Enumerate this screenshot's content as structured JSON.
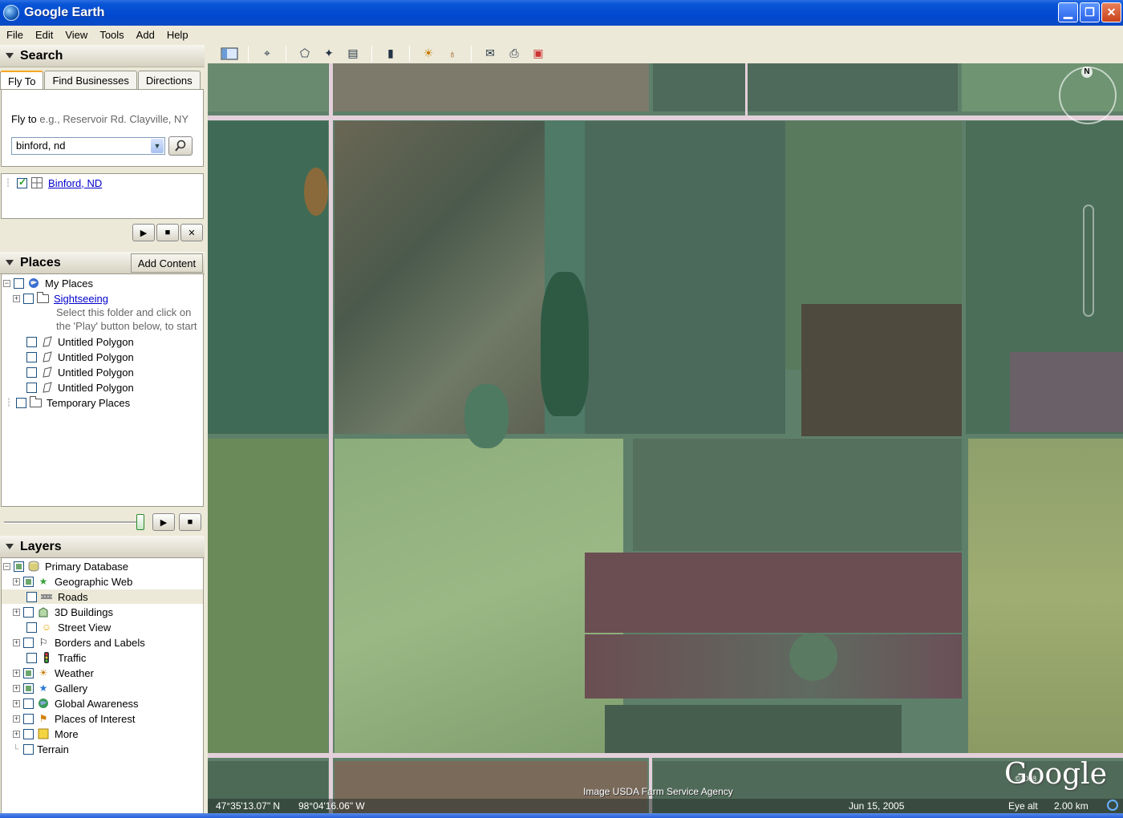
{
  "window": {
    "title": "Google Earth"
  },
  "menu": [
    "File",
    "Edit",
    "View",
    "Tools",
    "Add",
    "Help"
  ],
  "search": {
    "header": "Search",
    "tabs": [
      "Fly To",
      "Find Businesses",
      "Directions"
    ],
    "flyto_label": "Fly to",
    "flyto_hint": "e.g., Reservoir Rd. Clayville, NY",
    "query": "binford, nd",
    "result": "Binford, ND"
  },
  "places": {
    "header": "Places",
    "add_content": "Add Content",
    "my_places": "My Places",
    "sightseeing": "Sightseeing",
    "sightseeing_desc_1": "Select this folder and click on",
    "sightseeing_desc_2": "the 'Play' button below, to start",
    "polygons": [
      "Untitled Polygon",
      "Untitled Polygon",
      "Untitled Polygon",
      "Untitled Polygon"
    ],
    "temporary": "Temporary Places"
  },
  "layers": {
    "header": "Layers",
    "items": [
      {
        "label": "Primary Database",
        "icon": "database-icon"
      },
      {
        "label": "Geographic Web",
        "icon": "star-icon"
      },
      {
        "label": "Roads",
        "icon": "road-icon"
      },
      {
        "label": "3D Buildings",
        "icon": "building-icon"
      },
      {
        "label": "Street View",
        "icon": "person-icon"
      },
      {
        "label": "Borders and Labels",
        "icon": "flag-icon"
      },
      {
        "label": "Traffic",
        "icon": "traffic-icon"
      },
      {
        "label": "Weather",
        "icon": "sun-icon"
      },
      {
        "label": "Gallery",
        "icon": "star-icon"
      },
      {
        "label": "Global Awareness",
        "icon": "globe-icon"
      },
      {
        "label": "Places of Interest",
        "icon": "flag-icon"
      },
      {
        "label": "More",
        "icon": "note-icon"
      },
      {
        "label": "Terrain",
        "icon": ""
      }
    ]
  },
  "map": {
    "credit": "Image USDA Farm Service Agency",
    "logo": "Google",
    "copyright": "©2008",
    "compass_n": "N",
    "lat": "47°35'13.07\" N",
    "lon": "98°04'16.06\" W",
    "date": "Jun 15, 2005",
    "eye_alt_label": "Eye alt",
    "eye_alt": "2.00 km"
  }
}
